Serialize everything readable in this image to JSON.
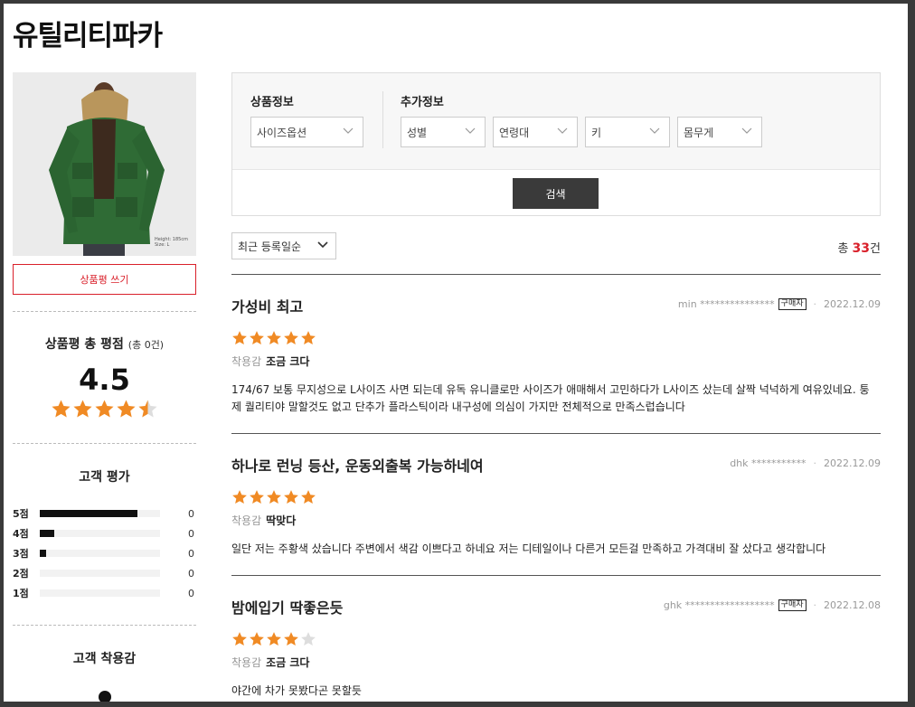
{
  "page": {
    "title": "유틸리티파카"
  },
  "product": {
    "image_caption": "Height: 185cm Size: L",
    "write_review_label": "상품평 쓰기"
  },
  "rating": {
    "label": "상품평 총 평점",
    "count_label": "(총 0건)",
    "score": "4.5",
    "stars": 4.5
  },
  "distribution": {
    "title": "고객 평가",
    "rows": [
      {
        "label": "5점",
        "count": "0",
        "fill": 0.81
      },
      {
        "label": "4점",
        "count": "0",
        "fill": 0.12
      },
      {
        "label": "3점",
        "count": "0",
        "fill": 0.05
      },
      {
        "label": "2점",
        "count": "0",
        "fill": 0
      },
      {
        "label": "1점",
        "count": "0",
        "fill": 0
      }
    ]
  },
  "fit": {
    "title": "고객 착용감"
  },
  "filters": {
    "product_info_title": "상품정보",
    "extra_info_title": "추가정보",
    "size_option": "사이즈옵션",
    "gender": "성별",
    "age": "연령대",
    "height": "키",
    "weight": "몸무게",
    "search_label": "검색"
  },
  "list": {
    "sort_label": "최근 등록일순",
    "total_prefix": "총",
    "total_count": "33",
    "total_suffix": "건"
  },
  "reviews": [
    {
      "title": "가성비 최고",
      "author": "min ***************",
      "badge": "구매자",
      "date": "2022.12.09",
      "stars": 5,
      "fit_label": "착용감",
      "fit_value": "조금 크다",
      "body": "174/67 보통 무지성으로 L사이즈 사면 되는데 유독 유니클로만 사이즈가 애매해서 고민하다가 L사이즈 샀는데 살짝 넉넉하게 여유있네요. 퉁제 퀄리티야 말할것도 없고 단추가 플라스틱이라 내구성에 의심이 가지만 전체적으로 만족스럽습니다"
    },
    {
      "title": "하나로 런닝 등산, 운동외출복 가능하네여",
      "author": "dhk ***********",
      "badge": "",
      "date": "2022.12.09",
      "stars": 5,
      "fit_label": "착용감",
      "fit_value": "딱맞다",
      "body": "일단 저는 주황색 샀습니다 주변에서 색감 이쁘다고 하네요 저는 디테일이나 다른거 모든걸 만족하고 가격대비 잘 샀다고 생각합니다"
    },
    {
      "title": "밤에입기 딱좋은듯",
      "author": "ghk ******************",
      "badge": "구매자",
      "date": "2022.12.08",
      "stars": 4,
      "fit_label": "착용감",
      "fit_value": "조금 크다",
      "body": "야간에 차가 못봤다곤 못할듯"
    }
  ],
  "colors": {
    "accent_red": "#d9202a",
    "star_orange": "#f08a24",
    "star_empty": "#dddddd",
    "button_dark": "#3a3a3a"
  }
}
